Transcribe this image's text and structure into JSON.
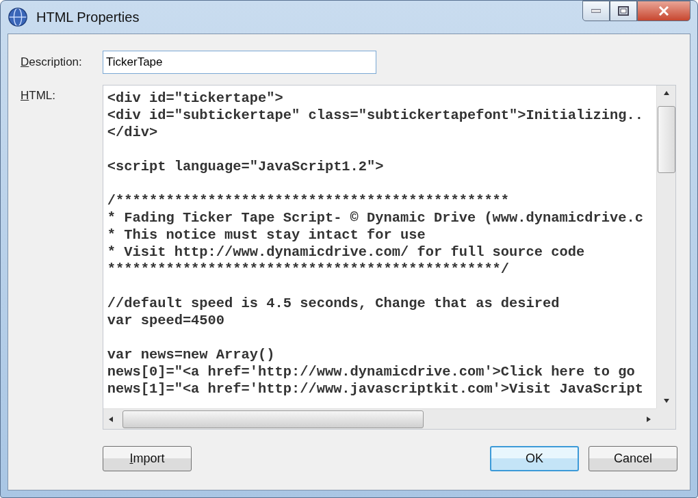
{
  "window": {
    "title": "HTML Properties"
  },
  "description": {
    "label": "Description:",
    "label_underline_first": true,
    "value": "TickerTape",
    "focused": true
  },
  "html": {
    "label": "HTML:",
    "label_underline_first": true,
    "content": "<div id=\"tickertape\">\n<div id=\"subtickertape\" class=\"subtickertapefont\">Initializing..\n</div>\n\n<script language=\"JavaScript1.2\">\n\n/***********************************************\n* Fading Ticker Tape Script- © Dynamic Drive (www.dynamicdrive.c\n* This notice must stay intact for use\n* Visit http://www.dynamicdrive.com/ for full source code\n***********************************************/\n\n//default speed is 4.5 seconds, Change that as desired\nvar speed=4500\n\nvar news=new Array()\nnews[0]=\"<a href='http://www.dynamicdrive.com'>Click here to go\nnews[1]=\"<a href='http://www.javascriptkit.com'>Visit JavaScript"
  },
  "buttons": [
    {
      "label": "Import",
      "underline_first": true,
      "default": false
    },
    {
      "label": "OK",
      "underline_first": false,
      "default": true
    },
    {
      "label": "Cancel",
      "underline_first": false,
      "default": false
    }
  ]
}
